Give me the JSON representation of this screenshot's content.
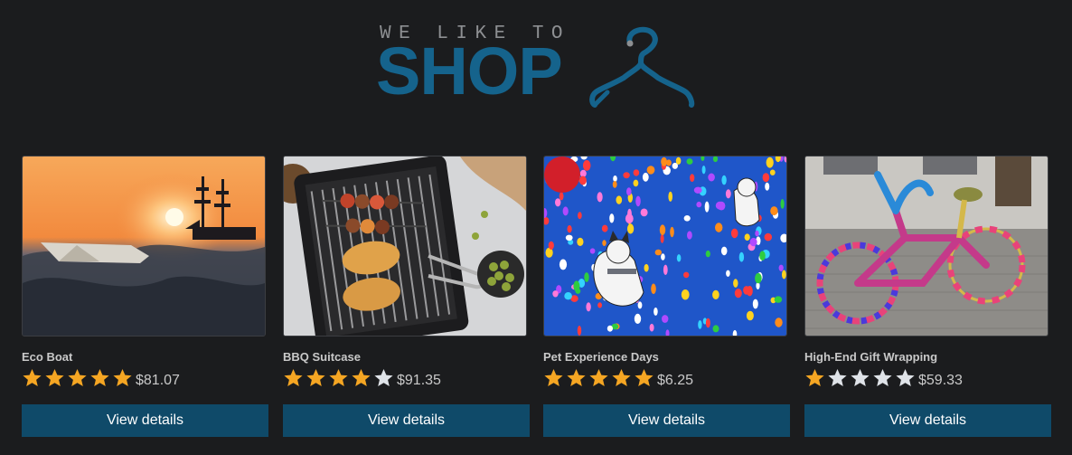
{
  "brand": {
    "tagline": "WE LIKE TO",
    "wordmark": "SHOP",
    "icon": "hanger-icon",
    "color": "#15638c"
  },
  "colors": {
    "background": "#1b1c1e",
    "button": "#0f4a69",
    "star_filled": "#f5a623",
    "star_empty": "#dfe3e8"
  },
  "products": [
    {
      "name": "Eco Boat",
      "rating": 5,
      "max_rating": 5,
      "price": "$81.07",
      "button_label": "View details",
      "image": "paper boat on the sea at sunset with a sailing ship"
    },
    {
      "name": "BBQ Suitcase",
      "rating": 4,
      "max_rating": 5,
      "price": "$91.35",
      "button_label": "View details",
      "image": "portable grill with skewers and corn"
    },
    {
      "name": "Pet Experience Days",
      "rating": 5,
      "max_rating": 5,
      "price": "$6.25",
      "button_label": "View details",
      "image": "dogs floating among colorful balloons"
    },
    {
      "name": "High-End Gift Wrapping",
      "rating": 1,
      "max_rating": 5,
      "price": "$59.33",
      "button_label": "View details",
      "image": "bicycle wrapped in colorful knitting"
    }
  ]
}
